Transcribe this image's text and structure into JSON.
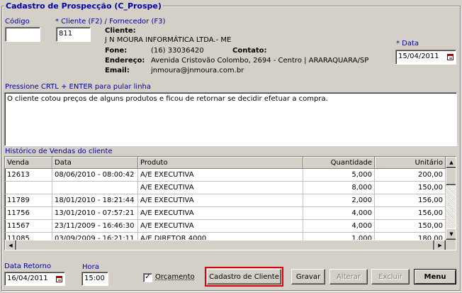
{
  "form": {
    "title": "Cadastro de Prospecção (C_Prospe)",
    "codigo_label": "Código",
    "codigo_value": "",
    "cliente_label": "* Cliente (F2) / Fornecedor (F3)",
    "cliente_value": "811",
    "data_label": "* Data",
    "data_value": "15/04/2011"
  },
  "client_info": {
    "cliente_label": "Cliente:",
    "cliente_name": "J N MOURA INFORMÁTICA LTDA.- ME",
    "fone_label": "Fone:",
    "fone_value": "(16) 33036420",
    "contato_label": "Contato:",
    "contato_value": "",
    "endereco_label": "Endereço:",
    "endereco_value": "Avenida Cristovão Colombo, 2694 - Centro | ARARAQUARA/SP",
    "email_label": "Email:",
    "email_value": "jnmoura@jnmoura.com.br"
  },
  "notes": {
    "hint": "Pressione CRTL + ENTER para pular linha",
    "text": "O cliente cotou preços de alguns produtos e ficou de retornar se decidir efetuar a compra."
  },
  "history": {
    "title": "Histórico de Vendas do cliente",
    "columns": [
      "Venda",
      "Data",
      "Produto",
      "Quantidade",
      "Unitário"
    ],
    "rows": [
      [
        "12613",
        "08/06/2010 - 08:00:42",
        "A/E EXECUTIVA",
        "5,000",
        "200,00"
      ],
      [
        "",
        "",
        "A/E EXECUTIVA",
        "8,000",
        "150,00"
      ],
      [
        "11789",
        "18/01/2010 - 18:21:44",
        "A/E EXECUTIVA",
        "2,000",
        "156,00"
      ],
      [
        "11756",
        "13/01/2010 - 07:57:21",
        "A/E EXECUTIVA",
        "4,000",
        "156,00"
      ],
      [
        "11567",
        "23/11/2009 - 16:46:30",
        "A/E EXECUTIVA",
        "4,000",
        "150,00"
      ],
      [
        "11085",
        "03/09/2009 - 16:21:11",
        "A/E DIRETOR 4000",
        "1,000",
        "180,00"
      ]
    ]
  },
  "bottom": {
    "retorno_label": "Data Retorno",
    "retorno_value": "16/04/2011",
    "hora_label": "Hora",
    "hora_value": "15:00",
    "orcamento_label": "Orçamento",
    "orcamento_checked": true,
    "cadastro_button": "Cadastro de Cliente",
    "gravar_button": "Gravar",
    "alterar_button": "Alterar",
    "excluir_button": "Excluir",
    "menu_button": "Menu"
  },
  "colors": {
    "label_blue": "#0000a8",
    "highlight_red": "#e00000",
    "window_bg": "#d4d0c8"
  }
}
